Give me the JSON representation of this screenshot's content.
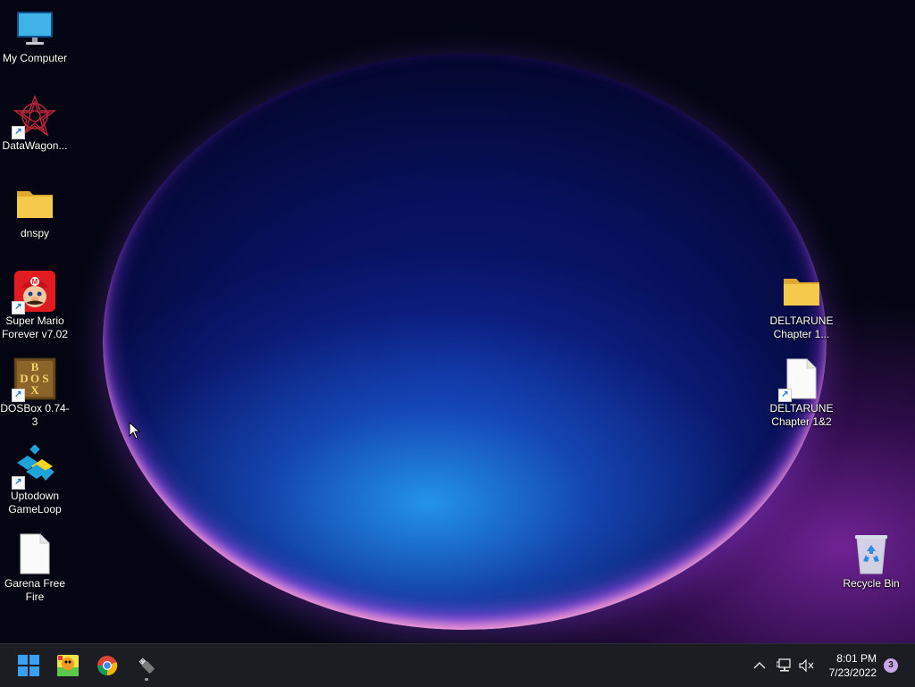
{
  "desktop": {
    "icons_left": [
      {
        "label": "My Computer",
        "icon": "monitor-icon"
      },
      {
        "label": "DataWagon...",
        "icon": "datawagon-icon",
        "shortcut": true
      },
      {
        "label": "dnspy",
        "icon": "folder-icon"
      },
      {
        "label": "Super Mario Forever v7.02",
        "icon": "mario-icon",
        "shortcut": true
      },
      {
        "label": "DOSBox 0.74-3",
        "icon": "dosbox-icon",
        "shortcut": true
      },
      {
        "label": "Uptodown GameLoop",
        "icon": "gameloop-icon",
        "shortcut": true
      },
      {
        "label": "Garena Free Fire",
        "icon": "document-icon"
      }
    ],
    "icons_right": [
      {
        "label": "DELTARUNE Chapter 1...",
        "icon": "folder-icon"
      },
      {
        "label": "DELTARUNE Chapter 1&2",
        "icon": "document-icon",
        "shortcut": true
      },
      {
        "label": "Recycle Bin",
        "icon": "recycle-bin-icon"
      }
    ],
    "dosbox_letters": [
      "B",
      "D",
      "O",
      "S",
      "X"
    ]
  },
  "taskbar": {
    "pinned": [
      "start-button",
      "paint-app",
      "chrome",
      "usb-tool"
    ],
    "clock_time": "8:01 PM",
    "clock_date": "7/23/2022",
    "notification_count": "3",
    "tray_icons": [
      "chevron-up-icon",
      "network-icon",
      "speaker-muted-icon"
    ]
  },
  "colors": {
    "taskbar_bg": "#1b1d22",
    "start_blue": "#3aa0f3",
    "folder_yellow": "#f5c94b"
  }
}
